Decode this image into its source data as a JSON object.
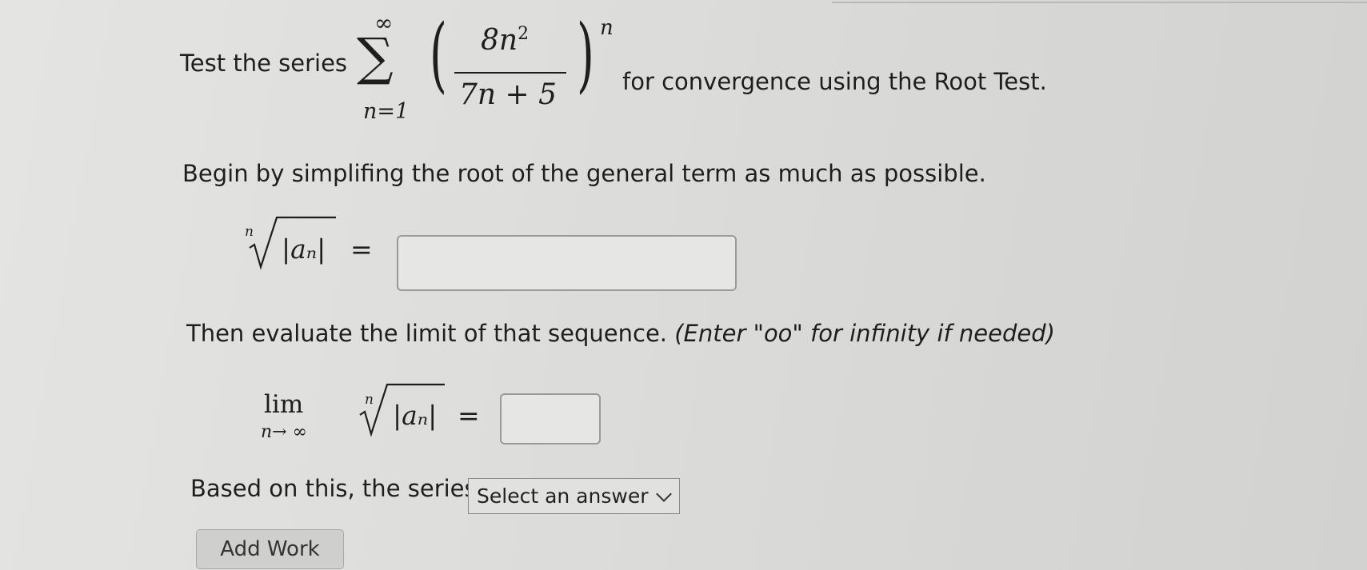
{
  "question": {
    "intro_text": "Test the series",
    "series": {
      "sum_upper": "∞",
      "sum_lower": "n=1",
      "numerator_base": "8n",
      "numerator_power": "2",
      "denominator": "7n + 5",
      "outer_exponent": "n"
    },
    "after_text": "for convergence using the Root Test."
  },
  "step1": {
    "instruction": "Begin by simplifing the root of the general term as much as possible.",
    "radical_index": "n",
    "radicand": "|aₙ|",
    "equals": "=",
    "input_value": ""
  },
  "step2": {
    "instruction_plain": "Then evaluate the limit of that sequence.",
    "instruction_italic": "(Enter \"oo\" for infinity if needed)",
    "lim_word": "lim",
    "lim_sub": "n→ ∞",
    "radical_index": "n",
    "radicand": "|aₙ|",
    "equals": "=",
    "input_value": ""
  },
  "step3": {
    "label": "Based on this, the series",
    "select_value": "Select an answer"
  },
  "add_work_label": "Add Work"
}
